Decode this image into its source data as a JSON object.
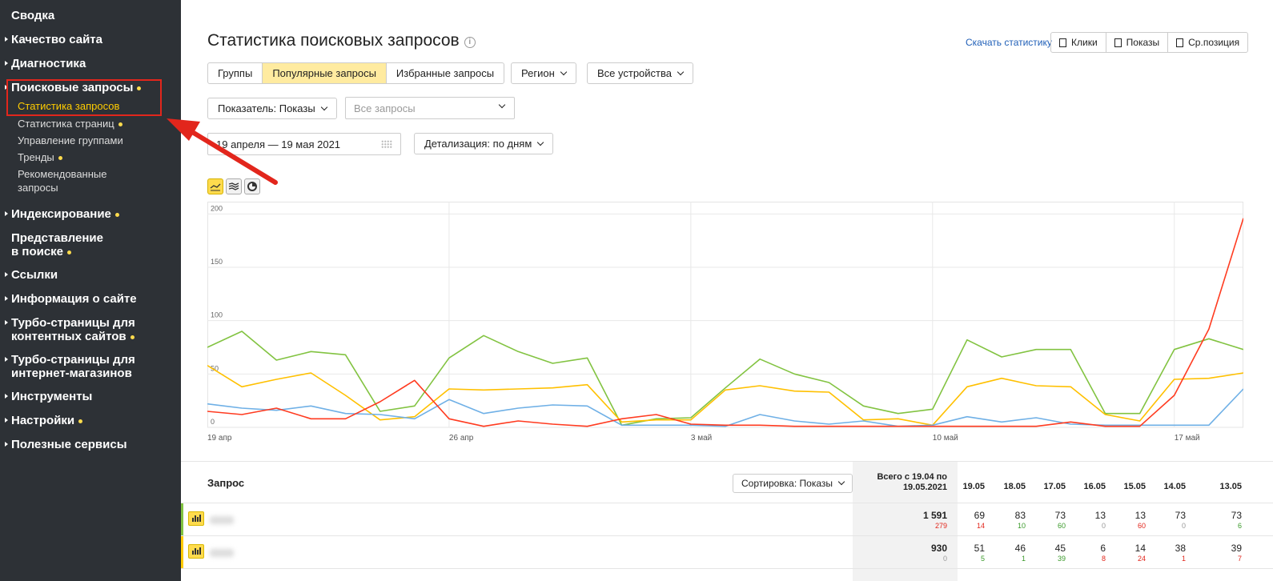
{
  "sidebar": {
    "items": [
      {
        "label": "Сводка"
      },
      {
        "label": "Качество сайта"
      },
      {
        "label": "Диагностика"
      },
      {
        "label": "Поисковые запросы"
      },
      {
        "label": "Индексирование"
      },
      {
        "label": "Представление"
      },
      {
        "label": "в поиске"
      },
      {
        "label": "Ссылки"
      },
      {
        "label": "Информация о сайте"
      },
      {
        "label": "Турбо-страницы для"
      },
      {
        "label": "контентных сайтов"
      },
      {
        "label": "Турбо-страницы для"
      },
      {
        "label": "интернет-магазинов"
      },
      {
        "label": "Инструменты"
      },
      {
        "label": "Настройки"
      },
      {
        "label": "Полезные сервисы"
      }
    ],
    "sub": [
      {
        "label": "Статистика запросов"
      },
      {
        "label": "Статистика страниц"
      },
      {
        "label": "Управление группами"
      },
      {
        "label": "Тренды"
      },
      {
        "label": "Рекомендованные"
      },
      {
        "label": "запросы"
      }
    ]
  },
  "header": {
    "title": "Статистика поисковых запросов",
    "download_link": "Скачать статистику",
    "download": [
      "Клики",
      "Показы",
      "Ср.позиция"
    ]
  },
  "filters": {
    "tabs": [
      "Группы",
      "Популярные запросы",
      "Избранные запросы"
    ],
    "region": "Регион",
    "devices": "Все устройства",
    "indicator": "Показатель: Показы",
    "queries_placeholder": "Все запросы",
    "date_range": "19 апреля — 19 мая 2021",
    "detail": "Детализация: по дням"
  },
  "chart_data": {
    "type": "line",
    "x": [
      "19.04",
      "20.04",
      "21.04",
      "22.04",
      "23.04",
      "24.04",
      "25.04",
      "26.04",
      "27.04",
      "28.04",
      "29.04",
      "30.04",
      "01.05",
      "02.05",
      "03.05",
      "04.05",
      "05.05",
      "06.05",
      "07.05",
      "08.05",
      "09.05",
      "10.05",
      "11.05",
      "12.05",
      "13.05",
      "14.05",
      "15.05",
      "16.05",
      "17.05",
      "18.05",
      "19.05"
    ],
    "xticks": [
      "19 апр",
      "26 апр",
      "3 май",
      "10 май",
      "17 май"
    ],
    "ylim": [
      0,
      210
    ],
    "yticks": [
      0,
      50,
      100,
      150,
      200
    ],
    "grid": true,
    "series": [
      {
        "color": "#82c341",
        "values": [
          75,
          90,
          63,
          71,
          68,
          15,
          20,
          65,
          86,
          71,
          60,
          65,
          2,
          8,
          9,
          37,
          64,
          50,
          42,
          20,
          13,
          17,
          82,
          66,
          73,
          73,
          13,
          13,
          73,
          83,
          73
        ]
      },
      {
        "color": "#ffc000",
        "values": [
          58,
          38,
          45,
          51,
          30,
          7,
          10,
          36,
          35,
          36,
          37,
          40,
          5,
          7,
          7,
          35,
          39,
          34,
          33,
          7,
          8,
          2,
          38,
          46,
          39,
          38,
          12,
          6,
          45,
          46,
          51
        ]
      },
      {
        "color": "#6fb0e6",
        "values": [
          22,
          18,
          16,
          20,
          13,
          12,
          8,
          26,
          13,
          18,
          21,
          20,
          2,
          2,
          2,
          1,
          12,
          6,
          3,
          6,
          1,
          2,
          10,
          5,
          9,
          3,
          2,
          2,
          2,
          2,
          36
        ]
      },
      {
        "color": "#ff3b20",
        "values": [
          15,
          12,
          18,
          8,
          8,
          24,
          44,
          8,
          1,
          6,
          3,
          1,
          8,
          12,
          3,
          2,
          2,
          1,
          1,
          1,
          1,
          1,
          1,
          1,
          1,
          5,
          1,
          1,
          30,
          92,
          196
        ]
      }
    ]
  },
  "table": {
    "query_header": "Запрос",
    "sort": "Сортировка: Показы",
    "total_header_1": "Всего с 19.04 по",
    "total_header_2": "19.05.2021",
    "dates": [
      "19.05",
      "18.05",
      "17.05",
      "16.05",
      "15.05",
      "14.05",
      "13.05"
    ],
    "rows": [
      {
        "color": "#82c341",
        "total": "1 591",
        "total_sub": "279",
        "cells": [
          [
            "69",
            "14",
            "red"
          ],
          [
            "83",
            "10",
            "green"
          ],
          [
            "73",
            "60",
            "green"
          ],
          [
            "13",
            "0",
            "grey"
          ],
          [
            "13",
            "60",
            "red"
          ],
          [
            "73",
            "0",
            "grey"
          ],
          [
            "73",
            "6",
            "green"
          ]
        ]
      },
      {
        "color": "#ffcc00",
        "total": "930",
        "total_sub": "0",
        "cells": [
          [
            "51",
            "5",
            "green"
          ],
          [
            "46",
            "1",
            "green"
          ],
          [
            "45",
            "39",
            "green"
          ],
          [
            "6",
            "8",
            "red"
          ],
          [
            "14",
            "24",
            "red"
          ],
          [
            "38",
            "1",
            "red"
          ],
          [
            "39",
            "7",
            "red"
          ]
        ]
      }
    ]
  }
}
